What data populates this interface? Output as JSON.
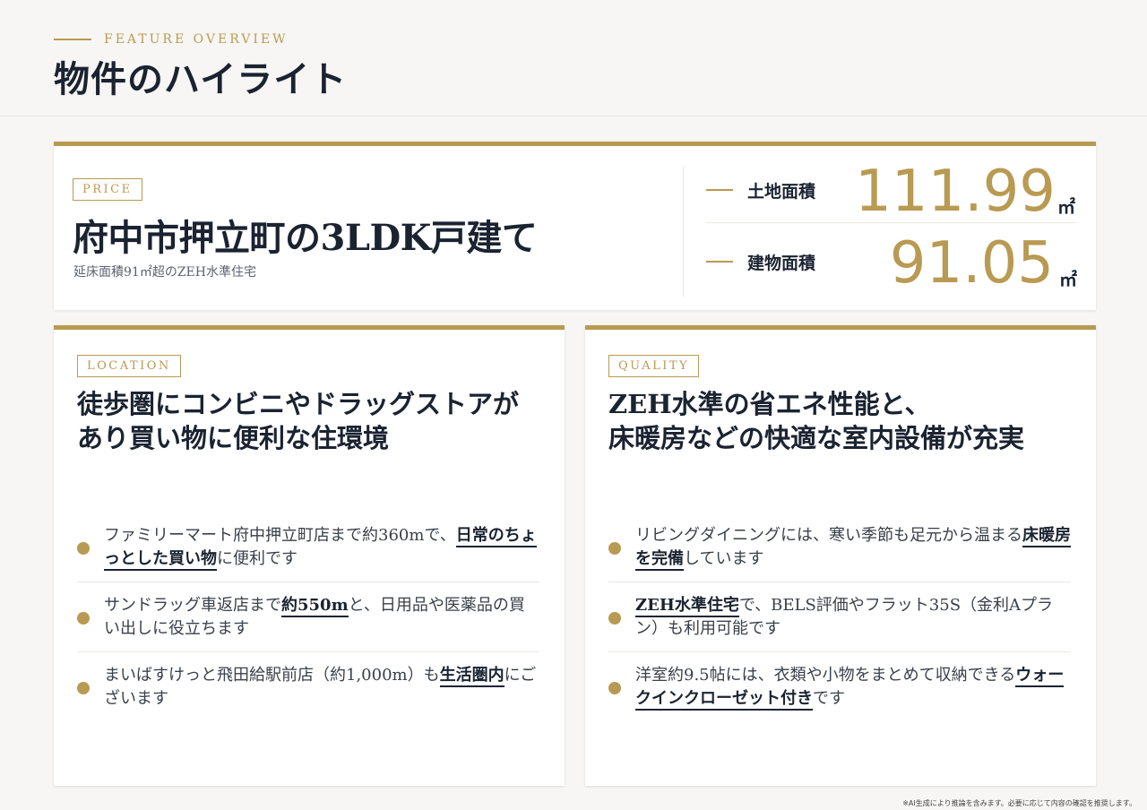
{
  "header": {
    "eyebrow": "FEATURE OVERVIEW",
    "title": "物件のハイライト"
  },
  "price": {
    "tag": "PRICE",
    "title": "府中市押立町の3LDK戸建て",
    "subtitle": "延床面積91㎡超のZEH水準住宅",
    "stats": [
      {
        "label": "土地面積",
        "value": "111.99",
        "unit": "㎡"
      },
      {
        "label": "建物面積",
        "value": "91.05",
        "unit": "㎡"
      }
    ]
  },
  "location": {
    "tag": "LOCATION",
    "heading_line1": "徒歩圏にコンビニやドラッグストアが",
    "heading_line2": "あり買い物に便利な住環境",
    "bullets": [
      {
        "pre": "ファミリーマート府中押立町店まで約360mで、",
        "hl": "日常のちょっとした買い物",
        "post": "に便利です"
      },
      {
        "pre": "サンドラッグ車返店まで",
        "hl": "約550m",
        "post": "と、日用品や医薬品の買い出しに役立ちます"
      },
      {
        "pre": "まいばすけっと飛田給駅前店（約1,000m）も",
        "hl": "生活圏内",
        "post": "にございます"
      }
    ]
  },
  "quality": {
    "tag": "QUALITY",
    "heading_line1": "ZEH水準の省エネ性能と、",
    "heading_line2": "床暖房などの快適な室内設備が充実",
    "bullets": [
      {
        "pre": "リビングダイニングには、寒い季節も足元から温まる",
        "hl": "床暖房を完備",
        "post": "しています"
      },
      {
        "pre": "",
        "hl": "ZEH水準住宅",
        "post": "で、BELS評価やフラット35S（金利Aプラン）も利用可能です"
      },
      {
        "pre": "洋室約9.5帖には、衣類や小物をまとめて収納できる",
        "hl": "ウォークインクローゼット付き",
        "post": "です"
      }
    ]
  },
  "footnote": "※AI生成により推論を含みます。必要に応じて内容の確認を推奨します。",
  "colors": {
    "accent": "#b99a52",
    "ink": "#1b2331",
    "background": "#f7f6f4"
  },
  "icons": {
    "bullet": "gold-dot",
    "stat_prefix": "gold-dash"
  }
}
